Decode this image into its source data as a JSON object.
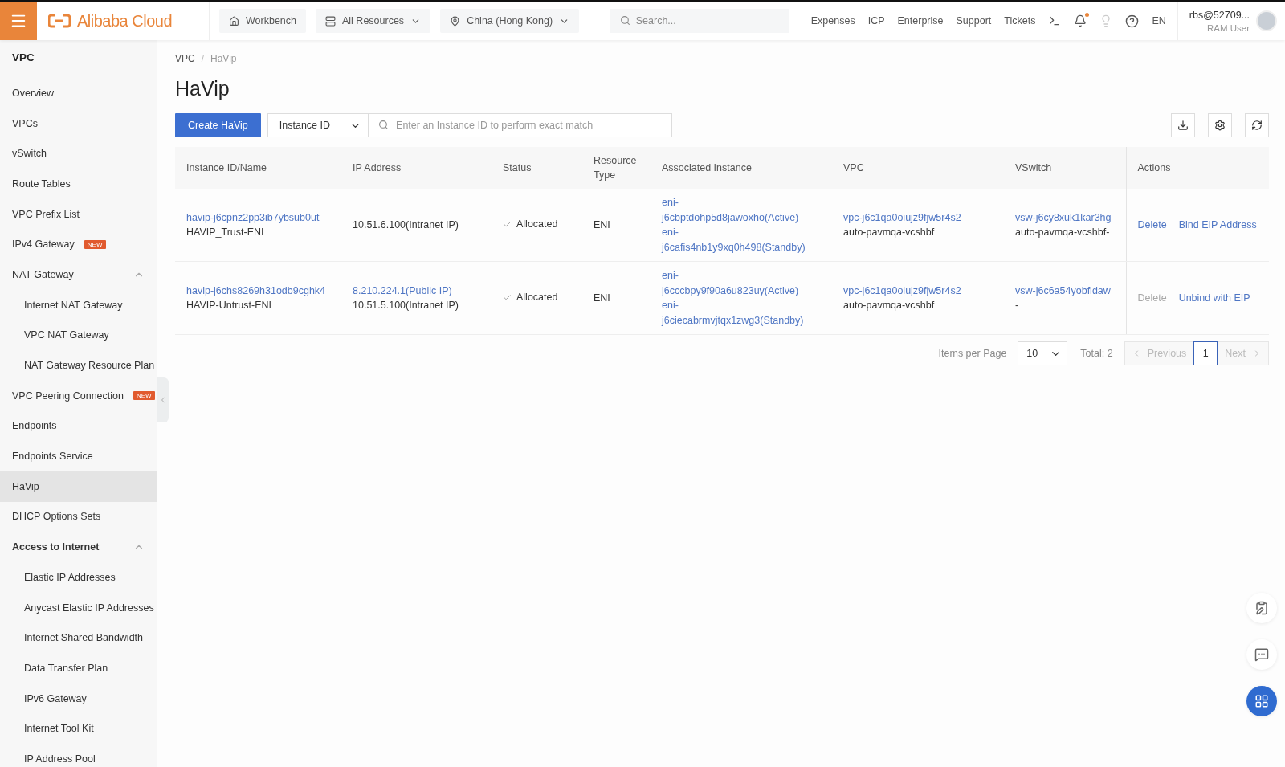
{
  "topbar": {
    "logo": "Alibaba Cloud",
    "workbench": "Workbench",
    "resources": "All Resources",
    "region": "China (Hong Kong)",
    "search": {
      "placeholder": "Search..."
    },
    "links": [
      "Expenses",
      "ICP",
      "Enterprise",
      "Support",
      "Tickets"
    ],
    "notifications_unread": true,
    "language": "EN",
    "user": {
      "name": "rbs@52709...",
      "role": "RAM User"
    }
  },
  "sidebar": {
    "title": "VPC",
    "items": [
      {
        "label": "Overview",
        "kind": "item",
        "selected": false
      },
      {
        "label": "VPCs",
        "kind": "item",
        "selected": false
      },
      {
        "label": "vSwitch",
        "kind": "item",
        "selected": false
      },
      {
        "label": "Route Tables",
        "kind": "item",
        "selected": false
      },
      {
        "label": "VPC Prefix List",
        "kind": "item",
        "selected": false
      },
      {
        "label": "IPv4 Gateway",
        "kind": "item",
        "selected": false,
        "badge": "NEW"
      },
      {
        "label": "NAT Gateway",
        "kind": "item",
        "selected": false,
        "expanded": true,
        "children": [
          {
            "label": "Internet NAT Gateway",
            "selected": false
          },
          {
            "label": "VPC NAT Gateway",
            "selected": false
          },
          {
            "label": "NAT Gateway Resource Plan",
            "selected": false
          }
        ]
      },
      {
        "label": "VPC Peering Connection",
        "kind": "item",
        "selected": false,
        "badge": "NEW"
      },
      {
        "label": "Endpoints",
        "kind": "item",
        "selected": false
      },
      {
        "label": "Endpoints Service",
        "kind": "item",
        "selected": false
      },
      {
        "label": "HaVip",
        "kind": "item",
        "selected": true
      },
      {
        "label": "DHCP Options Sets",
        "kind": "item",
        "selected": false
      },
      {
        "label": "Access to Internet",
        "kind": "section",
        "selected": false,
        "expanded": true,
        "children": [
          {
            "label": "Elastic IP Addresses",
            "selected": false
          },
          {
            "label": "Anycast Elastic IP Addresses",
            "selected": false
          },
          {
            "label": "Internet Shared Bandwidth",
            "selected": false
          },
          {
            "label": "Data Transfer Plan",
            "selected": false
          },
          {
            "label": "IPv6 Gateway",
            "selected": false
          },
          {
            "label": "Internet Tool Kit",
            "selected": false
          },
          {
            "label": "IP Address Pool",
            "selected": false
          }
        ]
      }
    ]
  },
  "breadcrumb": [
    "VPC",
    "HaVip"
  ],
  "breadcrumb_separator": "/",
  "page_title": "HaVip",
  "toolbar": {
    "create_button": "Create HaVip",
    "filter": "Instance ID",
    "search": {
      "placeholder": "Enter an Instance ID to perform exact match"
    }
  },
  "table": {
    "columns": [
      "Instance ID/Name",
      "IP Address",
      "Status",
      "Resource Type",
      "Associated Instance",
      "VPC",
      "VSwitch",
      "Actions"
    ],
    "rows": [
      {
        "id": "havip-j6cpnz2pp3ib7ybsub0ut",
        "name": "HAVIP_Trust-ENI",
        "ips": [
          {
            "text": "10.51.6.100(Intranet IP)",
            "kind": "intranet"
          }
        ],
        "status": "Allocated",
        "type": "ENI",
        "associated": [
          "eni-j6cbptdohp5d8jawoxho(Active)",
          "eni-j6cafis4nb1y9xq0h498(Standby)"
        ],
        "vpc": "vpc-j6c1qa0oiujz9fjw5r4s2",
        "vpc_name": "auto-pavmqa-vcshbf",
        "vswitch": "vsw-j6cy8xuk1kar3hg",
        "vswitch_name": "auto-pavmqa-vcshbf-",
        "actions": [
          {
            "label": "Delete",
            "disabled": false
          },
          {
            "label": "Bind EIP Address",
            "disabled": false
          }
        ]
      },
      {
        "id": "havip-j6chs8269h31odb9cghk4",
        "name": "HAVIP-Untrust-ENI",
        "ips": [
          {
            "text": "8.210.224.1(Public IP)",
            "kind": "public"
          },
          {
            "text": "10.51.5.100(Intranet IP)",
            "kind": "intranet"
          }
        ],
        "status": "Allocated",
        "type": "ENI",
        "associated": [
          "eni-j6cccbpy9f90a6u823uy(Active)",
          "eni-j6ciecabrmvjtqx1zwg3(Standby)"
        ],
        "vpc": "vpc-j6c1qa0oiujz9fjw5r4s2",
        "vpc_name": "auto-pavmqa-vcshbf",
        "vswitch": "vsw-j6c6a54yobfldaw",
        "vswitch_name": "-",
        "actions": [
          {
            "label": "Delete",
            "disabled": true
          },
          {
            "label": "Unbind with EIP",
            "disabled": false
          }
        ]
      }
    ]
  },
  "pagination": {
    "label": "Items per Page",
    "page_size": "10",
    "total": "Total: 2",
    "previous": {
      "label": "Previous",
      "disabled": true
    },
    "pages": [
      {
        "label": "1",
        "selected": true
      }
    ],
    "next": {
      "label": "Next",
      "disabled": true
    }
  }
}
